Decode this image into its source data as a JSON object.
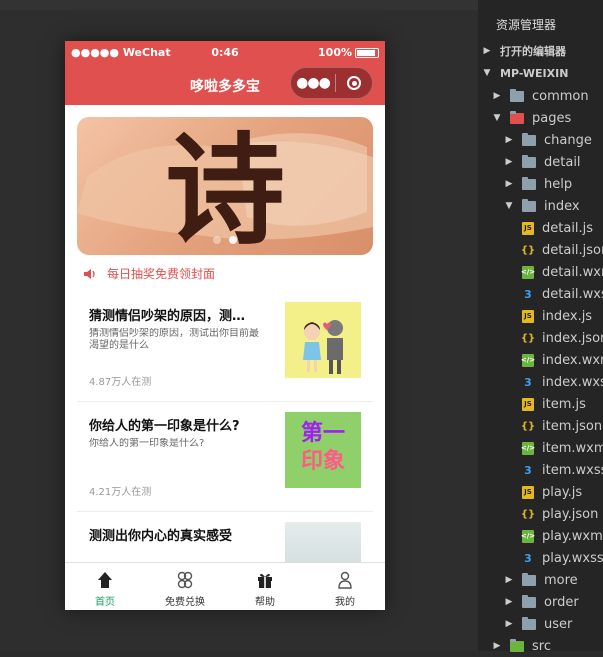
{
  "status": {
    "signal": "●●●●● WeChat",
    "time": "0:46",
    "battery": "100%"
  },
  "navbar": {
    "title": "哆啦多多宝"
  },
  "banner": {
    "glyph": "诗"
  },
  "notice": {
    "text": "每日抽奖免费领封面"
  },
  "cards": [
    {
      "title": "猜测情侣吵架的原因，测…",
      "desc": "猜测情侣吵架的原因，测试出你目前最渴望的是什么",
      "count": "4.87万人在测"
    },
    {
      "title": "你给人的第一印象是什么?",
      "desc": "你给人的第一印象是什么?",
      "count": "4.21万人在测",
      "thumb_text": [
        "第一",
        "印象"
      ]
    },
    {
      "title": "测测出你内心的真实感受",
      "desc": "",
      "count": ""
    }
  ],
  "tabbar": [
    {
      "label": "首页",
      "icon": "home-icon",
      "active": true
    },
    {
      "label": "免费兑换",
      "icon": "exchange-icon",
      "active": false
    },
    {
      "label": "帮助",
      "icon": "gift-icon",
      "active": false
    },
    {
      "label": "我的",
      "icon": "user-icon",
      "active": false
    }
  ],
  "explorer": {
    "header": "资源管理器",
    "open_editors": "打开的编辑器",
    "project": "MP-WEIXIN",
    "tree": [
      {
        "name": "common",
        "type": "folder"
      },
      {
        "name": "pages",
        "type": "folder-open"
      },
      {
        "name": "change",
        "type": "folder"
      },
      {
        "name": "detail",
        "type": "folder"
      },
      {
        "name": "help",
        "type": "folder"
      },
      {
        "name": "index",
        "type": "folder-open"
      },
      {
        "name": "detail.js",
        "type": "js"
      },
      {
        "name": "detail.json",
        "type": "json"
      },
      {
        "name": "detail.wxml",
        "type": "wxml"
      },
      {
        "name": "detail.wxss",
        "type": "wxss"
      },
      {
        "name": "index.js",
        "type": "js"
      },
      {
        "name": "index.json",
        "type": "json"
      },
      {
        "name": "index.wxml",
        "type": "wxml"
      },
      {
        "name": "index.wxss",
        "type": "wxss"
      },
      {
        "name": "item.js",
        "type": "js"
      },
      {
        "name": "item.json",
        "type": "json"
      },
      {
        "name": "item.wxml",
        "type": "wxml"
      },
      {
        "name": "item.wxss",
        "type": "wxss"
      },
      {
        "name": "play.js",
        "type": "js"
      },
      {
        "name": "play.json",
        "type": "json"
      },
      {
        "name": "play.wxml",
        "type": "wxml"
      },
      {
        "name": "play.wxss",
        "type": "wxss"
      },
      {
        "name": "more",
        "type": "folder"
      },
      {
        "name": "order",
        "type": "folder"
      },
      {
        "name": "user",
        "type": "folder"
      },
      {
        "name": "src",
        "type": "folder"
      }
    ]
  },
  "colors": {
    "brand": "#e0504f",
    "tab_active": "#19a15f"
  }
}
